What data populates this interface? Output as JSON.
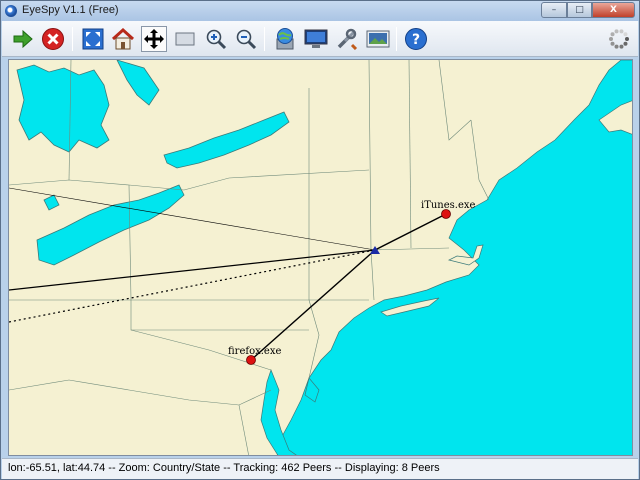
{
  "window": {
    "title": "EyeSpy V1.1 (Free)",
    "controls": {
      "minimize": "–",
      "maximize": "□",
      "close": "X"
    }
  },
  "toolbar": {
    "buttons": [
      {
        "name": "play-icon",
        "tooltip": ""
      },
      {
        "name": "stop-icon",
        "tooltip": ""
      },
      {
        "name": "fit-icon",
        "tooltip": ""
      },
      {
        "name": "home-icon",
        "tooltip": ""
      },
      {
        "name": "pan-icon",
        "tooltip": "",
        "pressed": true
      },
      {
        "name": "select-rect-icon",
        "tooltip": ""
      },
      {
        "name": "zoom-in-icon",
        "tooltip": ""
      },
      {
        "name": "zoom-out-icon",
        "tooltip": ""
      },
      {
        "name": "network-globe-icon",
        "tooltip": ""
      },
      {
        "name": "monitor-icon",
        "tooltip": ""
      },
      {
        "name": "tools-icon",
        "tooltip": ""
      },
      {
        "name": "screenshot-icon",
        "tooltip": ""
      },
      {
        "name": "help-icon",
        "tooltip": ""
      }
    ],
    "busy_indicator": "spinner-icon"
  },
  "map": {
    "colors": {
      "land": "#f5f1d2",
      "water": "#00e5ee",
      "border": "#5b7a6a",
      "line": "#000000",
      "peer": "#dd1111",
      "home": "#1b2aa5"
    },
    "peers": [
      {
        "label": "iTunes.exe",
        "lon": -71.06,
        "lat": 42.36
      },
      {
        "label": "firefox.exe",
        "lon": -77.04,
        "lat": 38.9
      }
    ],
    "home": {
      "lon": -74.0,
      "lat": 40.71
    }
  },
  "status": {
    "text": "lon:-65.51, lat:44.74 -- Zoom: Country/State -- Tracking: 462 Peers -- Displaying: 8 Peers"
  }
}
